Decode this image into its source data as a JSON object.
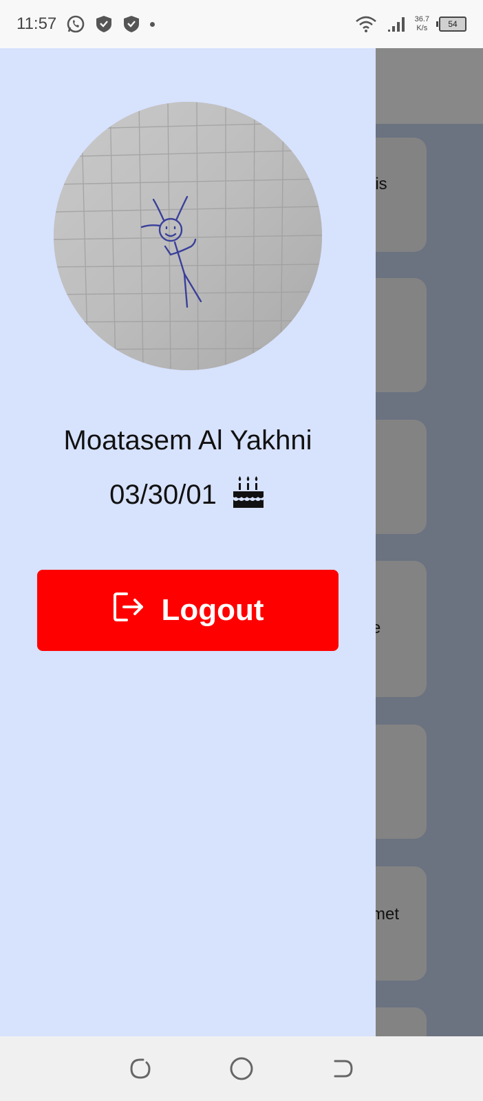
{
  "status_bar": {
    "time": "11:57",
    "net_speed_value": "36.7",
    "net_speed_unit": "K/s",
    "battery": "54",
    "icons": [
      "whatsapp-icon",
      "shield-icon",
      "shield-icon",
      "dot-icon",
      "wifi-icon",
      "signal-icon",
      "battery-icon"
    ]
  },
  "background_list": {
    "items": [
      "lis",
      "",
      "",
      "e",
      "",
      "met",
      ""
    ]
  },
  "drawer": {
    "user_name": "Moatasem Al Yakhni",
    "birthday": "03/30/01",
    "birthday_icon": "birthday-cake-icon",
    "logout_label": "Logout",
    "logout_icon": "logout-icon",
    "logout_color": "#ff0000",
    "background_color": "#d7e2fd"
  },
  "nav_bar": {
    "icons": [
      "recent-apps-icon",
      "home-icon",
      "back-icon"
    ]
  }
}
